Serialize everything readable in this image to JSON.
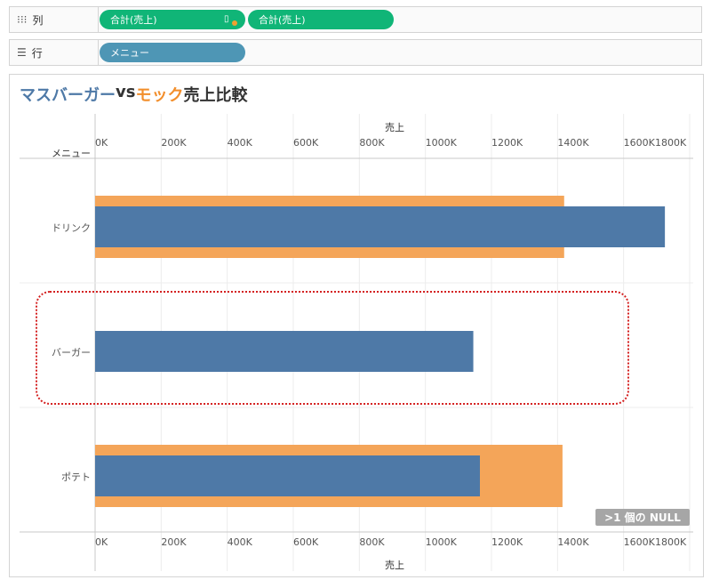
{
  "shelves": {
    "columns": {
      "label": "列",
      "icon": "columns-icon",
      "pills": [
        "合計(売上)",
        "合計(売上)"
      ]
    },
    "rows": {
      "label": "行",
      "icon": "rows-list-icon",
      "pills": [
        "メニュー"
      ]
    }
  },
  "title": {
    "part1": "マスバーガー",
    "part2": " vs ",
    "part3": "モック",
    "part4": " 売上比較",
    "colors": {
      "masu": "#4e79a7",
      "mock": "#f28e2b",
      "rest": "#333333"
    }
  },
  "null_indicator": ">1 個の NULL",
  "chart_data": {
    "type": "bar",
    "row_header": "メニュー",
    "xlabel": "売上",
    "xlim": [
      0,
      1800000
    ],
    "tick_labels": [
      "0K",
      "200K",
      "400K",
      "600K",
      "800K",
      "1000K",
      "1200K",
      "1400K",
      "1600K",
      "1800K"
    ],
    "categories": [
      "ドリンク",
      "バーガー",
      "ポテト"
    ],
    "series": [
      {
        "color": "#f4a559",
        "values": [
          1420000,
          null,
          1415000
        ]
      },
      {
        "color": "#4e79a7",
        "values": [
          1725000,
          1145000,
          1165000
        ]
      }
    ]
  }
}
